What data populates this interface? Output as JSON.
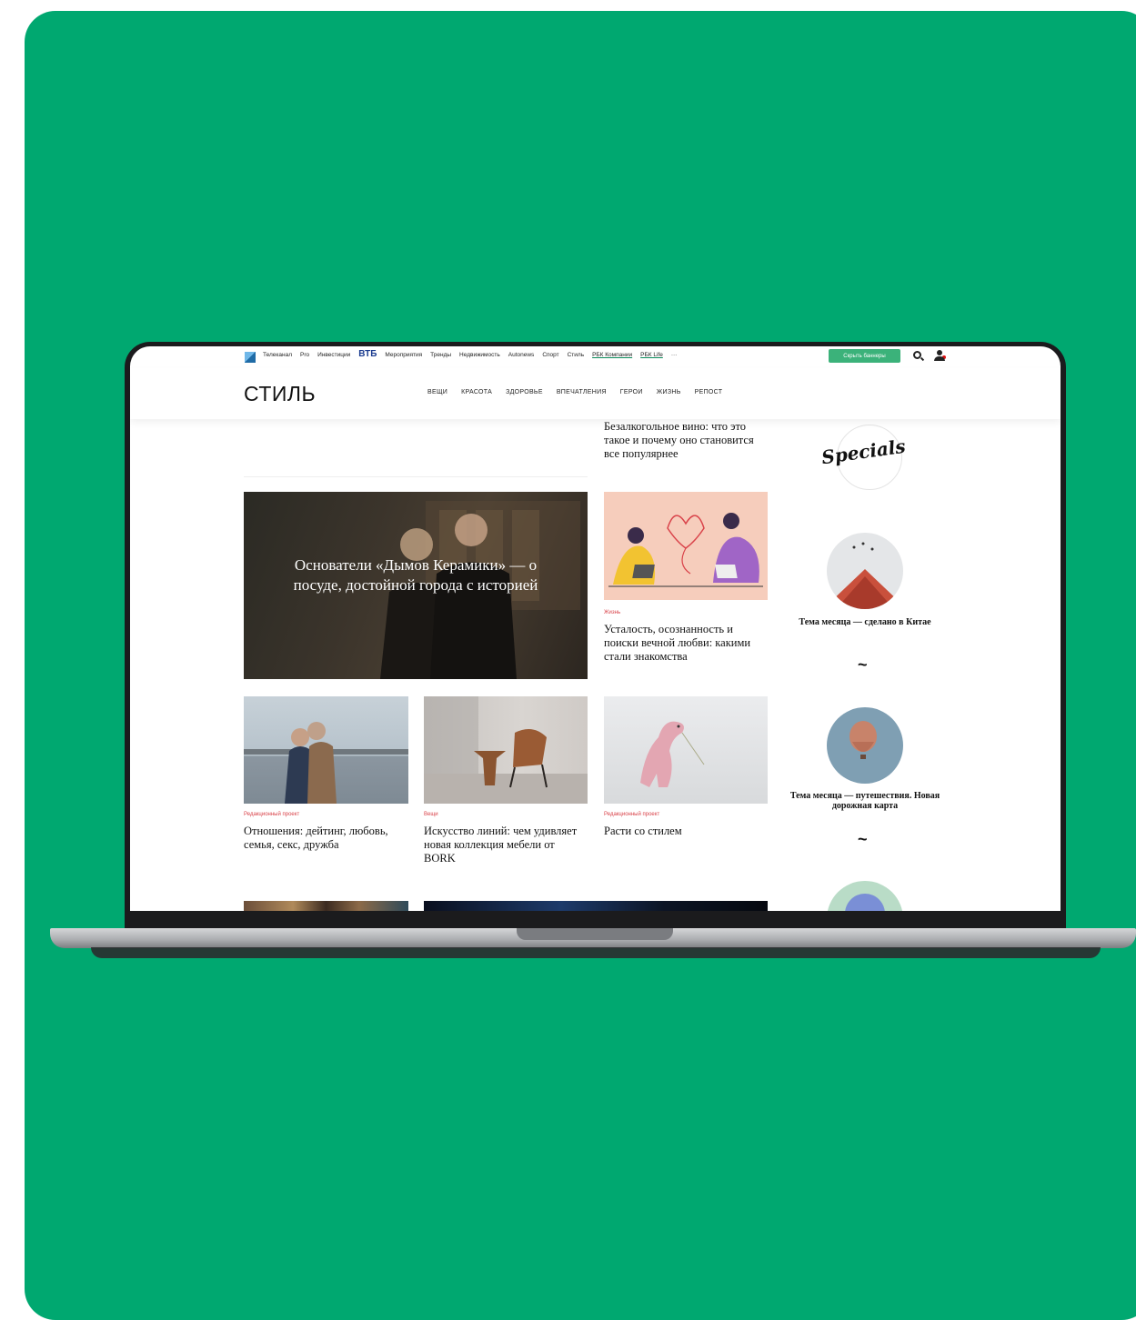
{
  "topbar": {
    "items": [
      "Телеканал",
      "Pro",
      "Инвестиции",
      "ВТБ",
      "Мероприятия",
      "Тренды",
      "Недвижимость",
      "Autonews",
      "Спорт",
      "Стиль",
      "РБК Компании",
      "РБК Life",
      "···"
    ],
    "hide_banners_label": "Скрыть баннеры"
  },
  "header": {
    "brand": "СТИЛЬ",
    "sections": [
      "ВЕЩИ",
      "КРАСОТА",
      "ЗДОРОВЬЕ",
      "ВПЕЧАТЛЕНИЯ",
      "ГЕРОИ",
      "ЖИЗНЬ",
      "РЕПОСТ"
    ]
  },
  "articles": {
    "top": {
      "title": "Безалкогольное вино: что это такое и почему оно становится все популярнее"
    },
    "feature": {
      "title": "Основатели «Дымов Керамики» — о посуде, достойной города с историей"
    },
    "fatigue": {
      "category": "Жизнь",
      "title": "Усталость, осознанность и поиски вечной любви: какими стали знакомства"
    },
    "relations": {
      "category": "Редакционный проект",
      "title": "Отношения: дейтинг, любовь, семья, секс, дружба"
    },
    "bork": {
      "category": "Вещи",
      "title": "Искусство линий: чем удивляет новая коллекция мебели от BORK"
    },
    "grow": {
      "category": "Редакционный проект",
      "title": "Расти со стилем"
    }
  },
  "sidebar": {
    "specials_label": "Specials",
    "china": {
      "title": "Тема месяца — сделано в Китае"
    },
    "travel": {
      "title": "Тема месяца — путешествия. Новая дорожная карта"
    },
    "separator": "~"
  },
  "colors": {
    "background": "#00a870",
    "accent_green": "#3bb27a",
    "category_red": "#d9434a"
  }
}
